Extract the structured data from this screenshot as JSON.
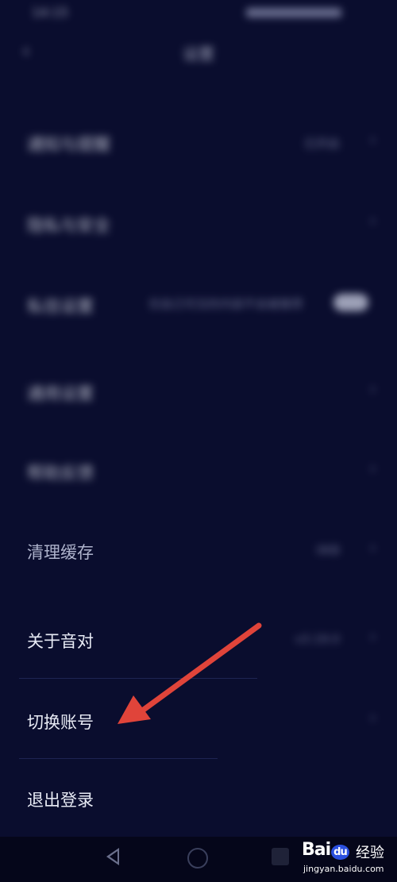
{
  "status_bar": {
    "time": "14:15"
  },
  "header": {
    "back_glyph": "‹",
    "title": "设置"
  },
  "rows_blurred": [
    {
      "label": "通知与提醒",
      "value": "已开启"
    },
    {
      "label": "隐私与安全",
      "value": ""
    },
    {
      "label": "私信设置",
      "value": "仅自己可见的内容不会被推荐"
    },
    {
      "label": "通用设置",
      "value": ""
    },
    {
      "label": "帮助反馈",
      "value": ""
    }
  ],
  "rows": {
    "clear_cache": {
      "label": "清理缓存",
      "value": "0KB"
    },
    "about": {
      "label": "关于音对",
      "value": "v3.19.0"
    },
    "switch_account": {
      "label": "切换账号"
    },
    "logout": {
      "label": "退出登录"
    }
  },
  "chevron_glyph": "›",
  "annotation": {
    "arrow_color": "#e0443a",
    "target": "switch_account"
  },
  "watermark": {
    "logo_left": "Bai",
    "logo_mid": "du",
    "cn": "经验",
    "url": "jingyan.baidu.com"
  },
  "colors": {
    "background": "#0a0d2e",
    "text": "#e8ebf5",
    "muted": "#8e93b3",
    "arrow": "#e0443a"
  }
}
